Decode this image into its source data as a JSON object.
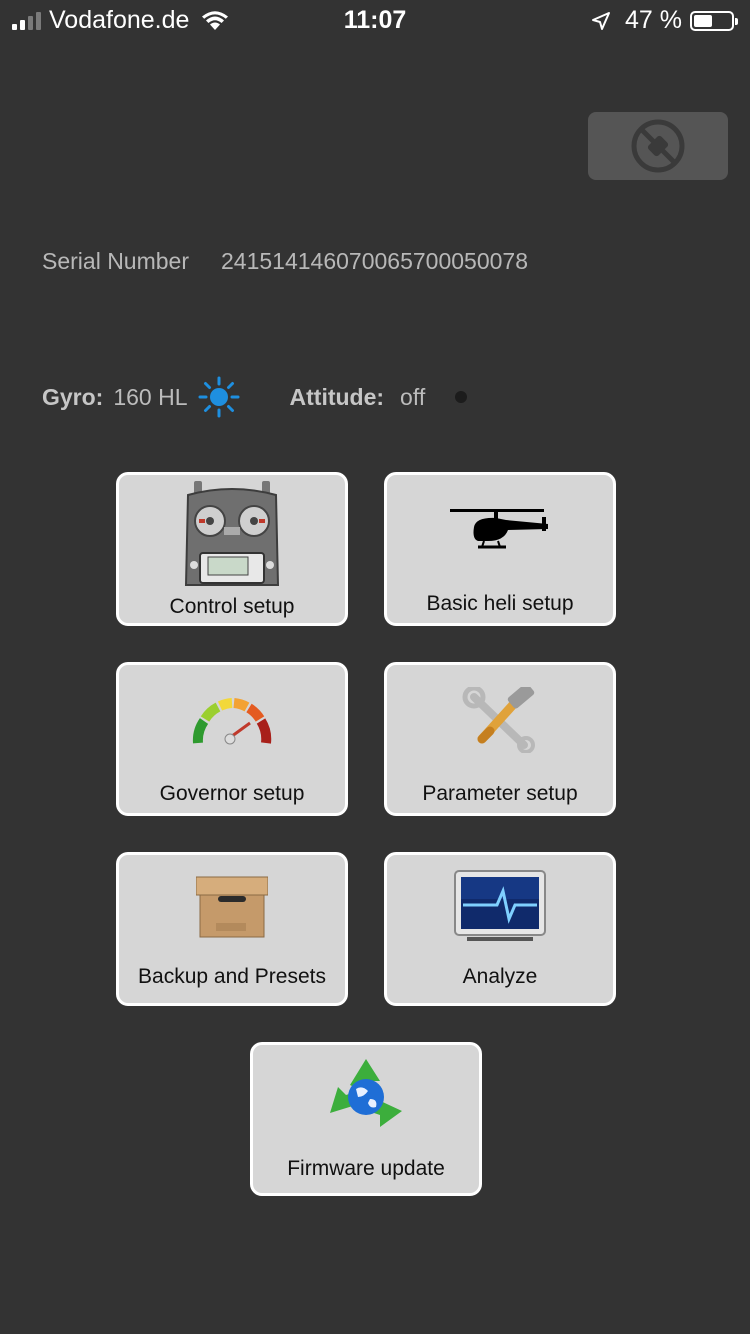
{
  "status_bar": {
    "carrier": "Vodafone.de",
    "time": "11:07",
    "battery_percent": "47 %",
    "battery_level": 0.47
  },
  "device": {
    "serial_label": "Serial Number",
    "serial_value": "241514146070065700050078"
  },
  "status": {
    "gyro_label": "Gyro:",
    "gyro_value": "160 HL",
    "gyro_indicator_color": "#1e8fe0",
    "attitude_label": "Attitude:",
    "attitude_value": "off"
  },
  "tiles": [
    {
      "label": "Control setup",
      "icon": "radio-transmitter-icon"
    },
    {
      "label": "Basic heli setup",
      "icon": "helicopter-icon"
    },
    {
      "label": "Governor setup",
      "icon": "gauge-icon"
    },
    {
      "label": "Parameter setup",
      "icon": "tools-icon"
    },
    {
      "label": "Backup and Presets",
      "icon": "archive-box-icon"
    },
    {
      "label": "Analyze",
      "icon": "monitor-pulse-icon"
    },
    {
      "label": "Firmware update",
      "icon": "recycle-globe-icon"
    }
  ]
}
